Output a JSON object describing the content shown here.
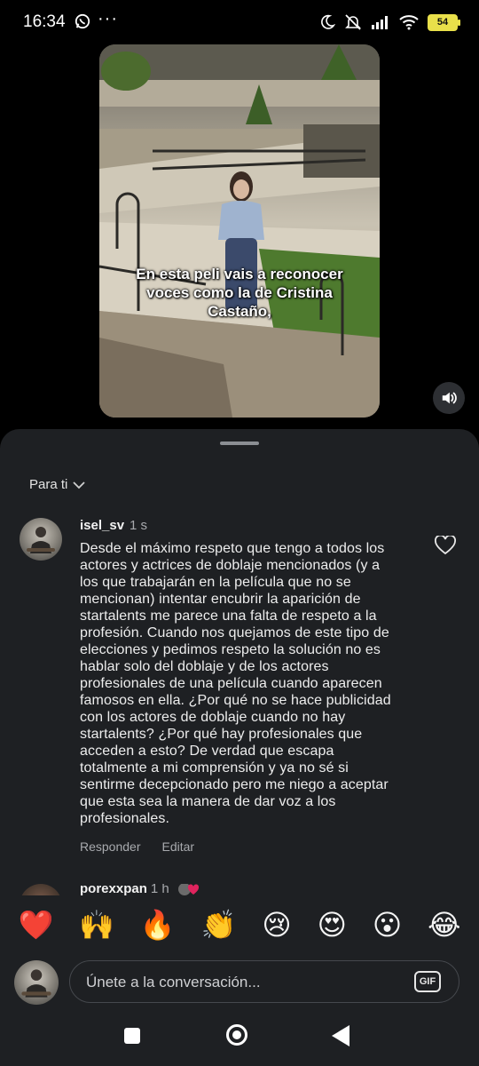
{
  "status_bar": {
    "time": "16:34",
    "more": "···",
    "battery": "54",
    "icons": [
      "whatsapp-icon",
      "moon-icon",
      "mute-icon",
      "signal-icon",
      "wifi-icon",
      "battery-icon"
    ]
  },
  "video": {
    "caption": "En esta peli vais a reconocer voces como la de Cristina Castaño,",
    "sound_icon": "volume-icon"
  },
  "comments_panel": {
    "filter_label": "Para ti",
    "comments": [
      {
        "username": "isel_sv",
        "time": "1 s",
        "text": "Desde el máximo respeto que tengo a todos los actores y actrices de doblaje mencionados (y a los que trabajarán en la película que no se mencionan) intentar encubrir la aparición de startalents me parece una falta de respeto a la profesión. Cuando nos quejamos de este tipo de elecciones y pedimos respeto la solución no es hablar solo del doblaje y de los actores profesionales de una película cuando aparecen famosos en ella. ¿Por qué no se hace publicidad con los actores de doblaje cuando no hay startalents? ¿Por qué hay profesionales que acceden a esto? De verdad que escapa totalmente a mi comprensión y ya no sé si sentirme decepcionado pero me niego a aceptar que esta sea la manera de dar voz a los profesionales.",
        "reply_label": "Responder",
        "edit_label": "Editar"
      },
      {
        "username": "porexxpan",
        "time": "1 h"
      }
    ]
  },
  "emoji_bar": [
    "❤️",
    "🙌",
    "🔥",
    "👏",
    "😢",
    "😍",
    "😮",
    "😂"
  ],
  "input": {
    "placeholder": "Únete a la conversación...",
    "gif_label": "GIF"
  },
  "colors": {
    "sheet_bg": "#1e2023",
    "battery": "#e9e04a",
    "muted_text": "#a8aaae"
  }
}
